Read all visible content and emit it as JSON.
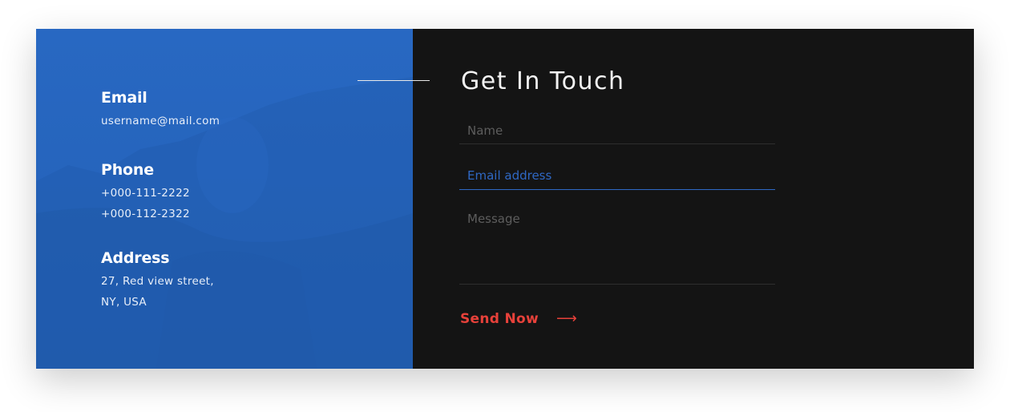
{
  "contact": {
    "email": {
      "title": "Email",
      "value": "username@mail.com"
    },
    "phone": {
      "title": "Phone",
      "numbers": [
        "+000-111-2222",
        "+000-112-2322"
      ]
    },
    "address": {
      "title": "Address",
      "lines": [
        "27, Red view street,",
        "NY, USA"
      ]
    }
  },
  "form": {
    "title": "Get In Touch",
    "name_placeholder": "Name",
    "email_placeholder": "Email address",
    "message_placeholder": "Message",
    "name_value": "",
    "email_value": "",
    "message_value": "",
    "submit_label": "Send Now",
    "submit_icon": "arrow-right-icon"
  },
  "colors": {
    "info_panel_bg": "#2465bd",
    "form_panel_bg": "#141414",
    "accent_red": "#e7413a",
    "focus_blue": "#2f68c4"
  }
}
